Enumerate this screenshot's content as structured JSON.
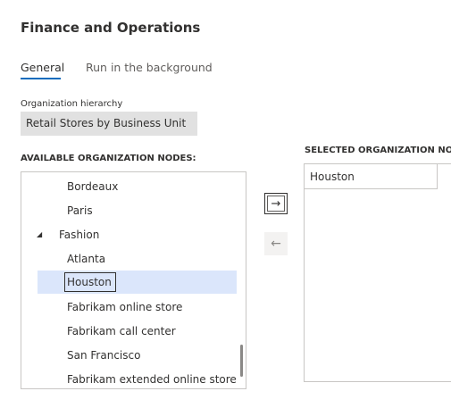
{
  "app": {
    "title": "Finance and Operations"
  },
  "tabs": [
    {
      "label": "General",
      "active": true
    },
    {
      "label": "Run in the background",
      "active": false
    }
  ],
  "org_hierarchy": {
    "label": "Organization hierarchy",
    "value": "Retail Stores by Business Unit"
  },
  "available": {
    "header": "AVAILABLE ORGANIZATION NODES:",
    "items": [
      {
        "label": "Bordeaux",
        "expandable": false,
        "selected": false
      },
      {
        "label": "Paris",
        "expandable": false,
        "selected": false
      },
      {
        "label": "Fashion",
        "expandable": true,
        "expanded": true,
        "selected": false
      },
      {
        "label": "Atlanta",
        "expandable": false,
        "selected": false
      },
      {
        "label": "Houston",
        "expandable": false,
        "selected": true
      },
      {
        "label": "Fabrikam online store",
        "expandable": false,
        "selected": false
      },
      {
        "label": "Fabrikam call center",
        "expandable": false,
        "selected": false
      },
      {
        "label": "San Francisco",
        "expandable": false,
        "selected": false
      },
      {
        "label": "Fabrikam extended online store",
        "expandable": false,
        "selected": false
      }
    ]
  },
  "buttons": {
    "add_icon": "arrow-right-icon",
    "add_glyph": "→",
    "remove_icon": "arrow-left-icon",
    "remove_glyph": "←"
  },
  "selected": {
    "header": "SELECTED ORGANIZATION NODI",
    "items": [
      "Houston"
    ]
  },
  "colors": {
    "accent": "#0f6cbd",
    "selection": "#dbe6fb",
    "field_bg": "#e1e1e1"
  }
}
